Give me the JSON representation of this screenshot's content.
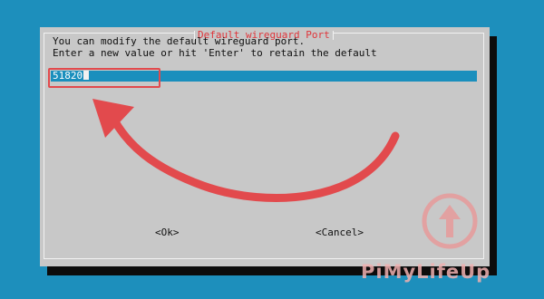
{
  "dialog": {
    "title": "Default wireguard Port",
    "message_line1": "You can modify the default wireguard port.",
    "message_line2": "Enter a new value or hit 'Enter' to retain the default",
    "input_value": "51820",
    "ok_label": "<Ok>",
    "cancel_label": "<Cancel>"
  },
  "watermark": {
    "text": "PiMyLifeUp"
  },
  "colors": {
    "desktop_bg": "#1d8fbc",
    "dialog_bg": "#c8c8c8",
    "title_text": "#e0353a",
    "annotation_red": "#e24a4d",
    "input_bar": "#1a8fbd"
  },
  "icons": {
    "annotation": "curved-arrow-icon",
    "logo": "up-arrow-circle-logo"
  }
}
